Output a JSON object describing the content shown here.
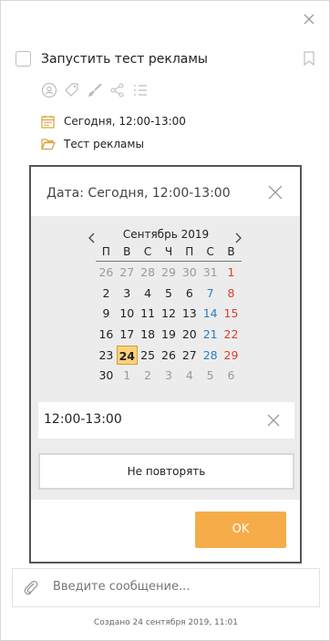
{
  "task": {
    "title": "Запустить тест рекламы",
    "date_text": "Сегодня, 12:00-13:00",
    "project": "Тест рекламы"
  },
  "toolbar_icons": [
    "user-circle-icon",
    "tag-icon",
    "paintbrush-icon",
    "share-icon",
    "checklist-icon"
  ],
  "modal": {
    "title": "Дата: Сегодня, 12:00-13:00",
    "month_label": "Сентябрь 2019",
    "weekdays": [
      "П",
      "В",
      "С",
      "Ч",
      "П",
      "С",
      "В"
    ],
    "weeks": [
      [
        "26",
        "27",
        "28",
        "29",
        "30",
        "31",
        "1"
      ],
      [
        "2",
        "3",
        "4",
        "5",
        "6",
        "7",
        "8"
      ],
      [
        "9",
        "10",
        "11",
        "12",
        "13",
        "14",
        "15"
      ],
      [
        "16",
        "17",
        "18",
        "19",
        "20",
        "21",
        "22"
      ],
      [
        "23",
        "24",
        "25",
        "26",
        "27",
        "28",
        "29"
      ],
      [
        "30",
        "1",
        "2",
        "3",
        "4",
        "5",
        "6"
      ]
    ],
    "selected_day": "24",
    "time_value": "12:00-13:00",
    "repeat_label": "Не повторять",
    "ok_label": "OK"
  },
  "message": {
    "placeholder": "Введите сообщение..."
  },
  "footer": {
    "created": "Создано 24 сентября 2019, 11:01"
  },
  "colors": {
    "accent": "#f5ac49",
    "selected_day_bg": "#f9d27a",
    "saturday": "#2a7fc0",
    "sunday": "#d9402b",
    "calendar_bg": "#ececec"
  }
}
